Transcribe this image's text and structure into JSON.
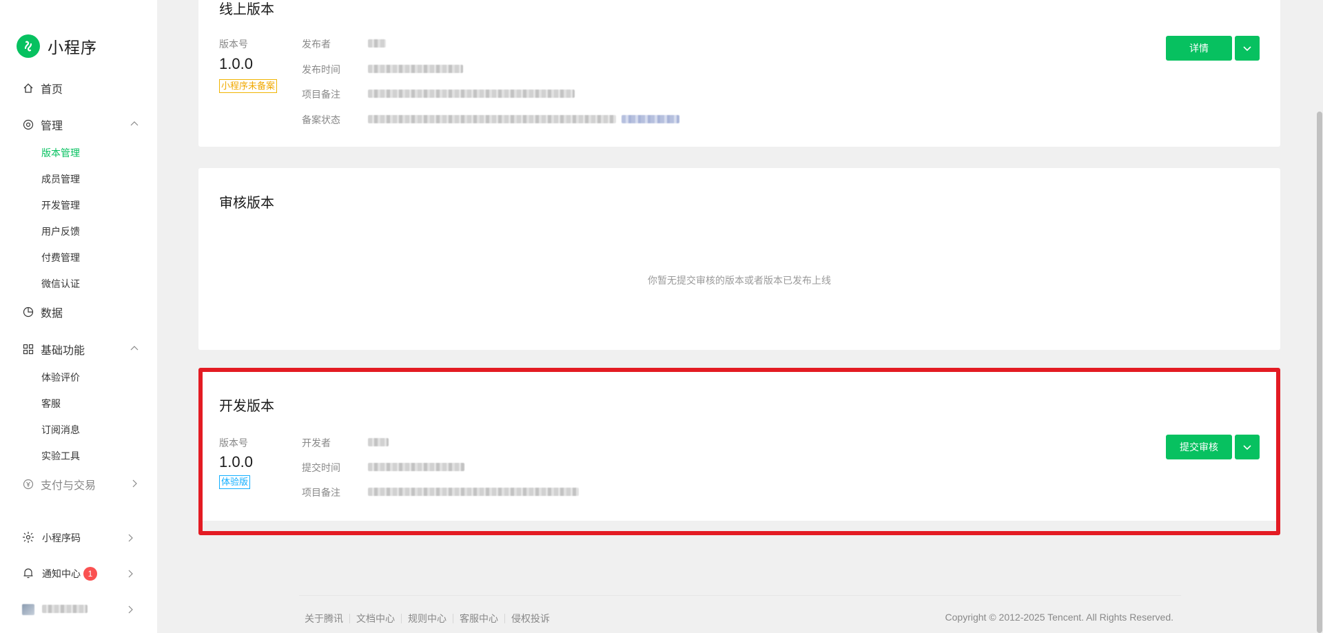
{
  "brand": {
    "name": "小程序",
    "color": "#07c160"
  },
  "sidebar": {
    "home": "首页",
    "manage": {
      "label": "管理",
      "items": [
        "版本管理",
        "成员管理",
        "开发管理",
        "用户反馈",
        "付费管理",
        "微信认证"
      ]
    },
    "data": "数据",
    "basic": {
      "label": "基础功能",
      "items": [
        "体验评价",
        "客服",
        "订阅消息",
        "实验工具"
      ]
    },
    "pay": "支付与交易",
    "qrcode": "小程序码",
    "notify": {
      "label": "通知中心",
      "count": "1"
    },
    "icons": [
      "home-icon",
      "manage-icon",
      "data-icon",
      "basic-icon",
      "pay-icon",
      "qrcode-icon",
      "bell-icon",
      "account-avatar"
    ]
  },
  "online": {
    "title": "线上版本",
    "version_label": "版本号",
    "version": "1.0.0",
    "tag": "小程序未备案",
    "fields": [
      "发布者",
      "发布时间",
      "项目备注",
      "备案状态"
    ],
    "detail_button": "详情"
  },
  "review": {
    "title": "审核版本",
    "empty": "你暂无提交审核的版本或者版本已发布上线"
  },
  "dev": {
    "title": "开发版本",
    "version_label": "版本号",
    "version": "1.0.0",
    "tag": "体验版 ",
    "fields": [
      "开发者",
      "提交时间",
      "项目备注"
    ],
    "submit_button": "提交审核"
  },
  "footer": {
    "links": [
      "关于腾讯",
      "文档中心",
      "规则中心",
      "客服中心",
      "侵权投诉"
    ],
    "copyright": "Copyright © 2012-2025 Tencent. All Rights Reserved."
  },
  "colors": {
    "accent": "#07c160",
    "highlight": "#e31b23",
    "warn": "#f0b400",
    "info": "#10aeff",
    "badge": "#fa5151"
  }
}
